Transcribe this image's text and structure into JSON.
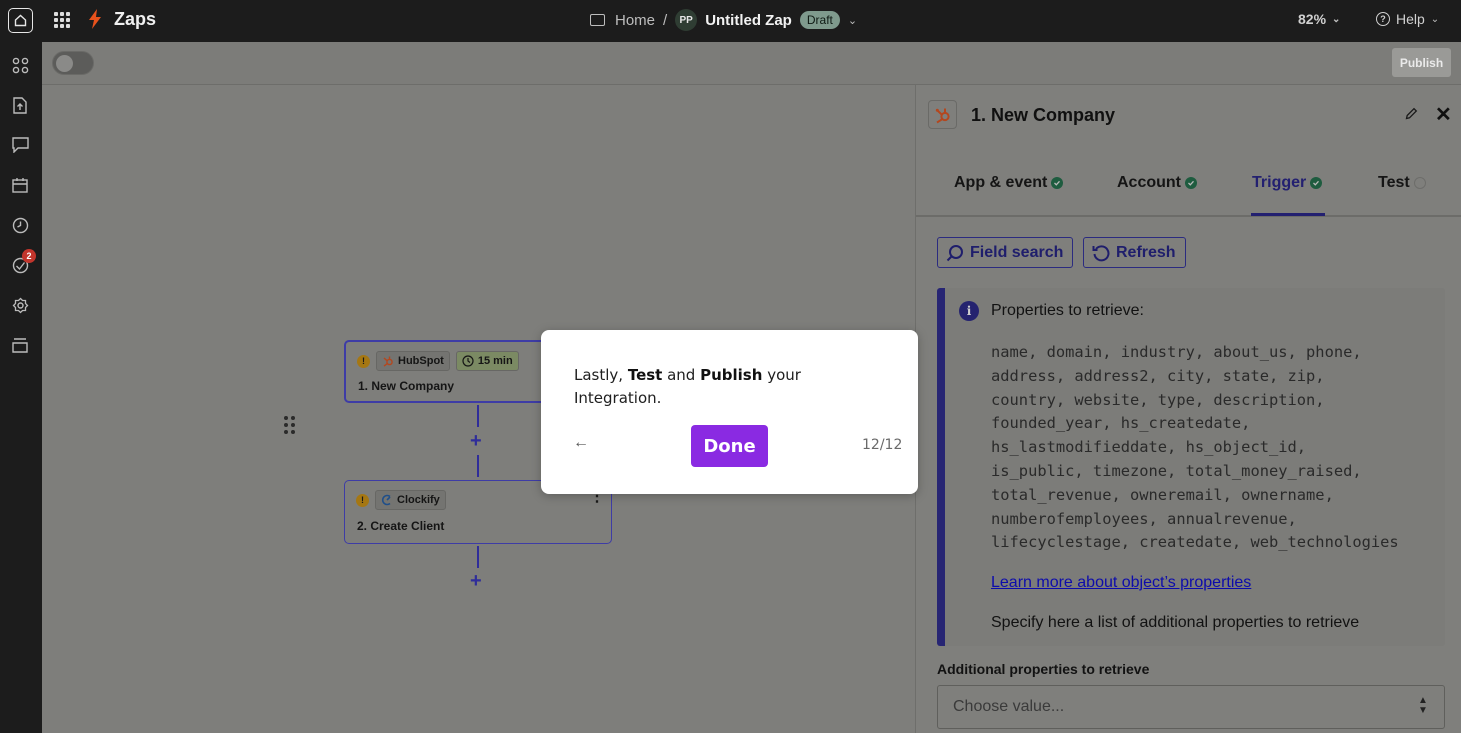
{
  "topbar": {
    "brand": "Zaps",
    "breadcrumb_home": "Home",
    "breadcrumb_sep": "/",
    "avatar_initials": "PP",
    "zap_name": "Untitled Zap",
    "status": "Draft",
    "zoom": "82%",
    "help": "Help"
  },
  "rail": {
    "icons": [
      "apps-icon",
      "upload-icon",
      "chat-icon",
      "calendar-icon",
      "history-icon",
      "activity-icon",
      "settings-icon",
      "layers-icon"
    ],
    "notification_count": "2"
  },
  "subbar": {
    "publish": "Publish"
  },
  "steps": [
    {
      "app": "HubSpot",
      "poll": "15 min",
      "title": "1. New Company"
    },
    {
      "app": "Clockify",
      "title": "2. Create Client"
    }
  ],
  "panel": {
    "title": "1. New Company",
    "tabs": [
      "App & event",
      "Account",
      "Trigger",
      "Test"
    ],
    "active_tab": "Trigger",
    "field_search": "Field search",
    "refresh": "Refresh",
    "info_heading": "Properties to retrieve:",
    "properties": "name, domain, industry, about_us, phone,\naddress, address2, city, state, zip,\ncountry, website, type, description,\nfounded_year, hs_createdate,\nhs_lastmodifieddate, hs_object_id,\nis_public, timezone, total_money_raised,\ntotal_revenue, owneremail, ownername,\nnumberofemployees, annualrevenue,\nlifecyclestage, createdate, web_technologies",
    "learn_link": "Learn more about object’s properties",
    "specify": "Specify here a list of additional properties to retrieve",
    "field_label": "Additional properties to retrieve",
    "field_placeholder": "Choose value..."
  },
  "tour": {
    "text_1": "Lastly, ",
    "bold_1": "Test",
    "text_2": " and ",
    "bold_2": "Publish",
    "text_3": " your Integration.",
    "done": "Done",
    "counter": "12/12"
  },
  "colors": {
    "accent": "#8a2ae2",
    "brand_bolt": "#e8521c",
    "primary": "#232070"
  }
}
